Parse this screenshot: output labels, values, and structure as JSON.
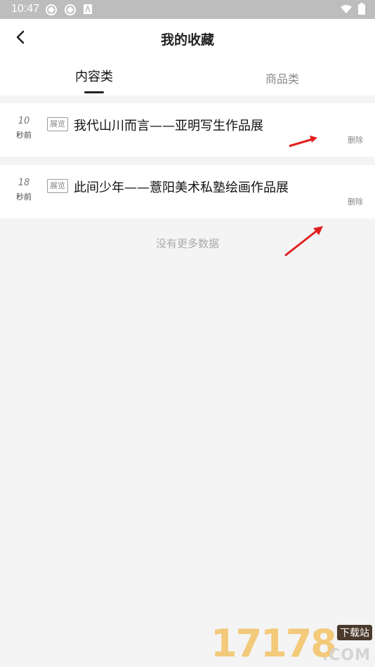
{
  "status_bar": {
    "time": "10:47"
  },
  "header": {
    "title": "我的收藏"
  },
  "tabs": [
    {
      "label": "内容类",
      "active": true
    },
    {
      "label": "商品类",
      "active": false
    }
  ],
  "items": [
    {
      "count": "10",
      "unit": "秒前",
      "badge": "展览",
      "title": "我代山川而言——亚明写生作品展",
      "delete_label": "删除"
    },
    {
      "count": "18",
      "unit": "秒前",
      "badge": "展览",
      "title": "此间少年——薏阳美术私塾绘画作品展",
      "delete_label": "删除"
    }
  ],
  "footer": {
    "no_more": "没有更多数据"
  },
  "watermark": {
    "digits": "17178",
    "site": "下载站",
    "suffix": ".COM"
  },
  "colors": {
    "accent": "#222222",
    "annotation_arrow": "#e02020",
    "watermark": "#f3c56d"
  }
}
